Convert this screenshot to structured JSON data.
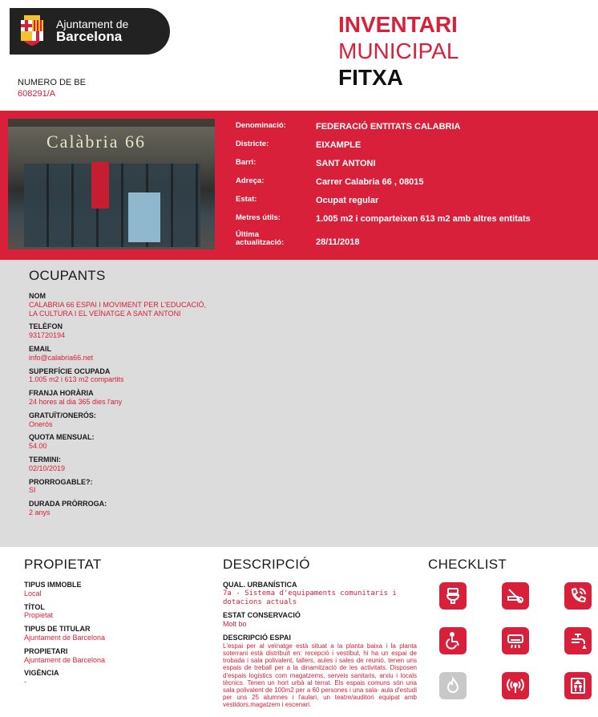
{
  "logo": {
    "line1": "Ajuntament de",
    "line2": "Barcelona",
    "icon": "coat-of-arms-icon"
  },
  "numero_be": {
    "label": "NUMERO DE BE",
    "value": "608291/A"
  },
  "title": {
    "line1": "INVENTARI",
    "line2": "MUNICIPAL",
    "line3": "FITXA"
  },
  "photo": {
    "sign_text": "Calàbria 66"
  },
  "details": [
    {
      "label": "Denominació:",
      "value": "FEDERACIÓ ENTITATS CALABRIA"
    },
    {
      "label": "Districte:",
      "value": "EIXAMPLE"
    },
    {
      "label": "Barri:",
      "value": "SANT ANTONI"
    },
    {
      "label": "Adreça:",
      "value": "Carrer Calabria 66 , 08015"
    },
    {
      "label": "Estat:",
      "value": "Ocupat regular"
    },
    {
      "label": "Metres útils:",
      "value": "1.005 m2 i comparteixen 613 m2 amb altres entitats"
    },
    {
      "label": "Última actualització:",
      "value": "28/11/2018"
    }
  ],
  "ocupants": {
    "title": "OCUPANTS",
    "fields": [
      {
        "label": "NOM",
        "value": "CALABRIA 66 ESPAI I MOVIMENT PER L'EDUCACIÓ, LA CULTURA I EL VEÏNATGE A SANT ANTONI"
      },
      {
        "label": "TELÈFON",
        "value": "931720194"
      },
      {
        "label": "EMAIL",
        "value": "info@calabria66.net"
      },
      {
        "label": "SUPERFÍCIE OCUPADA",
        "value": "1.005 m2 i 613 m2 compartits"
      },
      {
        "label": "FRANJA HORÀRIA",
        "value": "24 hores al dia 365 dies l'any"
      },
      {
        "label": "GRATUÏT/ONERÓS:",
        "value": "Onerós"
      },
      {
        "label": "QUOTA MENSUAL:",
        "value": "54.00"
      },
      {
        "label": "TERMINI:",
        "value": "02/10/2019"
      },
      {
        "label": "PRORROGABLE?:",
        "value": "SI"
      },
      {
        "label": "DURADA PRÒRROGA:",
        "value": "2 anys"
      }
    ]
  },
  "propietat": {
    "title": "PROPIETAT",
    "fields": [
      {
        "label": "TIPUS IMMOBLE",
        "value": "Local"
      },
      {
        "label": "TÍTOL",
        "value": "Propietat"
      },
      {
        "label": "TIPUS DE TITULAR",
        "value": "Ajuntament de Barcelona"
      },
      {
        "label": "PROPIETARI",
        "value": "Ajuntament de Barcelona"
      },
      {
        "label": "VIGÈNCIA",
        "value": "-"
      }
    ]
  },
  "descripcio": {
    "title": "DESCRIPCIÓ",
    "qual_label": "QUAL. URBANÍSTICA",
    "qual_value": "7a - Sistema d'equipaments comunitaris i dotacions actuals",
    "estat_label": "ESTAT CONSERVACIÓ",
    "estat_value": "Molt bo",
    "espai_label": "DESCRIPCIÓ ESPAI",
    "espai_value": "L'espai per al veïnatge està situat a la planta baixa i la planta soterrani està distribuït en: recepció i vestíbul, hi ha un espai de trobada i sala polivalent, tallers, aules i sales de reunió, tenen uns espais de treball per a la dinamització de les activitats. Disposen d'espais logístics com magatzems, serveis sanitaris, arxiu i locals tècnics. Tenen un hort urbà al terrat. Els espais comuns són una sala polivalent de 100m2 per a 60 persones i una sala- aula d'estudi per uns 25 alumnes i l'aulari, un teatre/auditori equipat amb vestidors,magatzem i escenari."
  },
  "checklist": {
    "title": "CHECKLIST",
    "icons": [
      {
        "name": "toilet-icon",
        "active": true
      },
      {
        "name": "no-smoking-icon",
        "active": true
      },
      {
        "name": "phone-icon",
        "active": true
      },
      {
        "name": "wheelchair-icon",
        "active": true
      },
      {
        "name": "air-conditioning-icon",
        "active": true
      },
      {
        "name": "water-tap-icon",
        "active": true
      },
      {
        "name": "fire-icon",
        "active": false
      },
      {
        "name": "wifi-signal-icon",
        "active": true
      },
      {
        "name": "elevator-icon",
        "active": true
      }
    ]
  },
  "colors": {
    "accent": "#d8203a",
    "band_grey": "#dcdcdc",
    "logo_bg": "#222222"
  }
}
